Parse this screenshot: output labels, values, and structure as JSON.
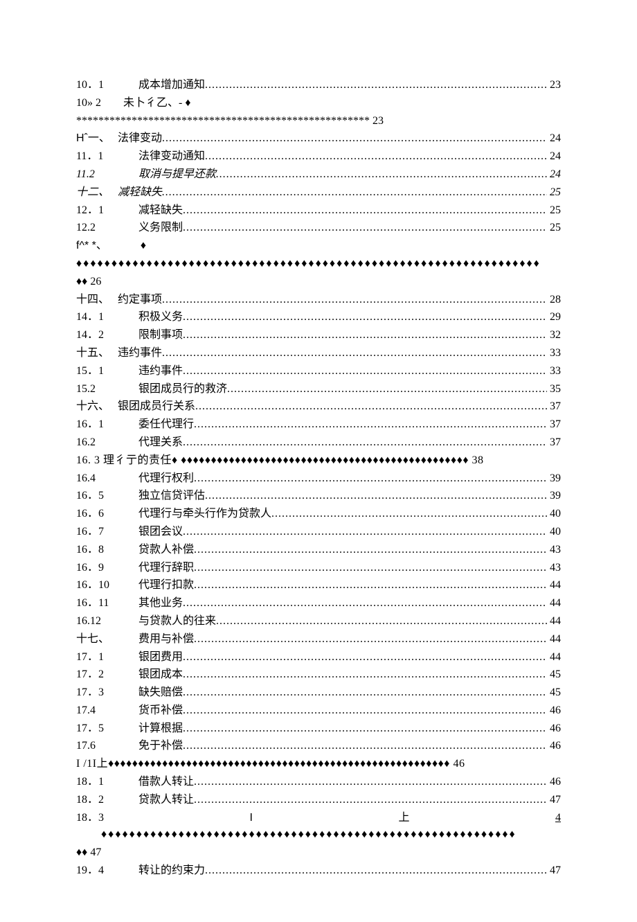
{
  "lines": {
    "r0": {
      "num": "10．1",
      "title": "成本增加通知",
      "page": "23"
    },
    "r1": {
      "text": "10» 2  未卜彳乙、- ♦"
    },
    "r2": {
      "text": "***************************************************** 23"
    },
    "r3": {
      "num": "Hˆ一、",
      "title": "法律变动",
      "page": "24",
      "style": "sans-num"
    },
    "r4": {
      "num": "11．1",
      "title": "法律变动通知",
      "page": "24"
    },
    "r5": {
      "num": "11.2",
      "title": "取消与提早还款",
      "page": "24",
      "italic": true
    },
    "r6": {
      "num": "十二、",
      "title": "减轻缺失",
      "page": "25",
      "italic": true
    },
    "r7": {
      "num": "12．1",
      "title": "减轻缺失",
      "page": "25"
    },
    "r8": {
      "num": "12.2",
      "title": "义务限制",
      "page": "25"
    },
    "r9": {
      "text": "f^* *、   ♦"
    },
    "r10": {
      "text": "♦♦♦♦♦♦♦♦♦♦♦♦♦♦♦♦♦♦♦♦♦♦♦♦♦♦♦♦♦♦♦♦♦♦♦♦♦♦♦♦♦♦♦♦♦♦♦♦♦♦♦♦♦♦♦♦♦♦♦♦♦♦♦♦♦♦"
    },
    "r11": {
      "text": "♦♦ 26"
    },
    "r12": {
      "num": "十四、",
      "title": "约定事项",
      "page": "28"
    },
    "r13": {
      "num": "14．1",
      "title": "积极义务",
      "page": "29"
    },
    "r14": {
      "num": "14．2",
      "title": "限制事项",
      "page": "32"
    },
    "r15": {
      "num": "十五、",
      "title": "违约事件",
      "page": "33"
    },
    "r16": {
      "num": "15．1",
      "title": "违约事件",
      "page": "33"
    },
    "r17": {
      "num": "15.2",
      "title": "银团成员行的救济",
      "page": "35"
    },
    "r18": {
      "num": "十六、",
      "title": "银团成员行关系",
      "page": "37"
    },
    "r19": {
      "num": "16．1",
      "title": "委任代理行",
      "page": "37"
    },
    "r20": {
      "num": "16.2",
      "title": "代理关系",
      "page": "37"
    },
    "r21": {
      "text": "16. 3 理彳亍的责任♦  ♦♦♦♦♦♦♦♦♦♦♦♦♦♦♦♦♦♦♦♦♦♦♦♦♦♦♦♦♦♦♦♦♦♦♦♦♦♦♦♦♦♦♦♦♦♦♦♦ 38"
    },
    "r22": {
      "num": "16.4",
      "title": "代理行权利",
      "page": "39"
    },
    "r23": {
      "num": "16．5",
      "title": "独立信贷评估",
      "page": "39"
    },
    "r24": {
      "num": "16．6",
      "title": "代理行与牵头行作为贷款人",
      "page": "40"
    },
    "r25": {
      "num": "16．7",
      "title": "银团会议",
      "page": "40"
    },
    "r26": {
      "num": "16．8",
      "title": "贷款人补偿",
      "page": "43"
    },
    "r27": {
      "num": "16．9",
      "title": "代理行辞职",
      "page": "43"
    },
    "r28": {
      "num": "16．10",
      "title": "代理行扣款",
      "page": "44"
    },
    "r29": {
      "num": "16．11",
      "title": "其他业务",
      "page": "44"
    },
    "r30": {
      "num": "16.12",
      "title": "与贷款人的往来",
      "page": "44"
    },
    "r31": {
      "num": "十七、",
      "title": "费用与补偿",
      "page": "44"
    },
    "r32": {
      "num": "17．1",
      "title": "银团费用",
      "page": "44"
    },
    "r33": {
      "num": "17．2",
      "title": "银团成本",
      "page": "45"
    },
    "r34": {
      "num": "17．3",
      "title": "缺失赔偿",
      "page": "45"
    },
    "r35": {
      "num": "17.4",
      "title": "货币补偿",
      "page": "46"
    },
    "r36": {
      "num": "17．5",
      "title": "计算根据",
      "page": "46"
    },
    "r37": {
      "num": "17.6",
      "title": "免于补偿",
      "page": "46"
    },
    "r38": {
      "text": "I /1I上♦♦♦♦♦♦♦♦♦♦♦♦♦♦♦♦♦♦♦♦♦♦♦♦♦♦♦♦♦♦♦♦♦♦♦♦♦♦♦♦♦♦♦♦♦♦♦♦♦♦♦♦♦♦♦♦♦ 46"
    },
    "r39": {
      "num": "18．1",
      "title": "借款人转让",
      "page": "46"
    },
    "r40": {
      "num": "18．2",
      "title": "贷款人转让",
      "page": "47"
    },
    "r41": {
      "left": "18．3",
      "mid": "I",
      "right_cn": "上",
      "far": "4"
    },
    "r42": {
      "text": "  ♦♦♦♦♦♦♦♦♦♦♦♦♦♦♦♦♦♦♦♦♦♦♦♦♦♦♦♦♦♦♦♦♦♦♦♦♦♦♦♦♦♦♦♦♦♦♦♦♦♦♦♦♦♦♦♦♦♦♦"
    },
    "r43": {
      "text": "♦♦ 47"
    },
    "r44": {
      "num": "19．4",
      "title": "转让的约束力",
      "page": "47"
    }
  }
}
